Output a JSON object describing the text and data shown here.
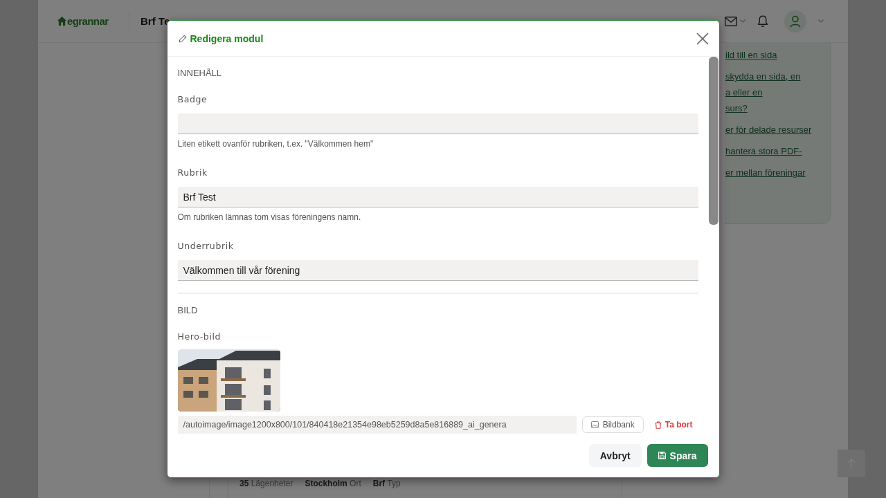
{
  "page": {
    "header": {
      "logo_text": "egrannar",
      "title": "Brf Te"
    },
    "side_panel": {
      "links": [
        {
          "lines": [
            "ild till en sida"
          ]
        },
        {
          "lines": [
            "skydda en sida, en",
            "a eller en",
            "surs?"
          ]
        },
        {
          "lines": [
            "er för delade resurser"
          ]
        },
        {
          "lines": [
            "hantera stora PDF-"
          ]
        },
        {
          "lines": [
            "er mellan föreningar"
          ]
        }
      ]
    },
    "stats": [
      "**35** Lägenheter",
      "**Stockholm** Ort",
      "**Brf** Typ"
    ]
  },
  "modal": {
    "title": "Redigera modul",
    "sections": [
      {
        "title": "INNEHÅLL",
        "fields": [
          {
            "kind": "text",
            "label": "Badge",
            "help": "Liten etikett ovanför rubriken, t.ex. \"Välkommen hem\""
          },
          {
            "kind": "text",
            "label": "Rubrik",
            "value": "Brf Test",
            "help": "Om rubriken lämnas tom visas föreningens namn."
          },
          {
            "kind": "text",
            "label": "Underrubrik",
            "value": "Välkommen till vår förening"
          }
        ]
      },
      {
        "title": "BILD",
        "fields": [
          {
            "kind": "image",
            "label": "Hero-bild",
            "value": "/autoimage/image1200x800/101/840418e21354e98eb5259d8a5e816889_ai_genera",
            "buttons": [
              {
                "kind": "bank",
                "label": "Bildbank"
              },
              {
                "kind": "remove",
                "label": "Ta bort"
              }
            ]
          }
        ]
      }
    ],
    "buttons": [
      {
        "kind": "secondary",
        "label": "Avbryt"
      },
      {
        "kind": "primary",
        "label": "Spara"
      }
    ]
  }
}
